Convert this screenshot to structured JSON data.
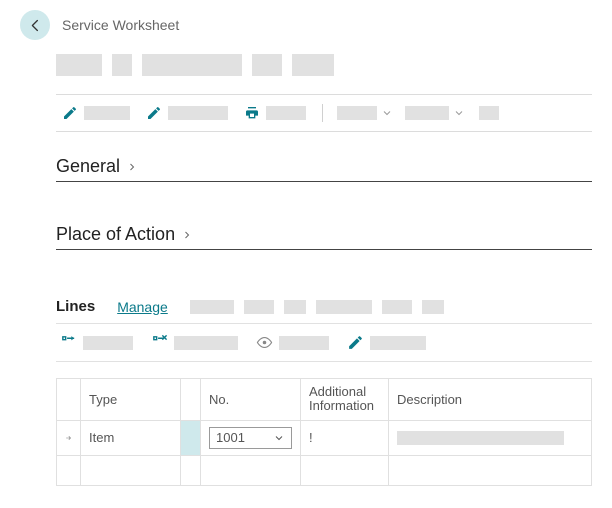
{
  "page_title": "Service Worksheet",
  "sections": {
    "general": "General",
    "place_of_action": "Place of Action"
  },
  "lines": {
    "tab_label": "Lines",
    "manage_label": "Manage"
  },
  "grid": {
    "headers": {
      "type": "Type",
      "no": "No.",
      "addl1": "Additional",
      "addl2": "Information",
      "desc": "Description"
    },
    "row": {
      "type": "Item",
      "no": "1001",
      "warn": "!"
    }
  }
}
